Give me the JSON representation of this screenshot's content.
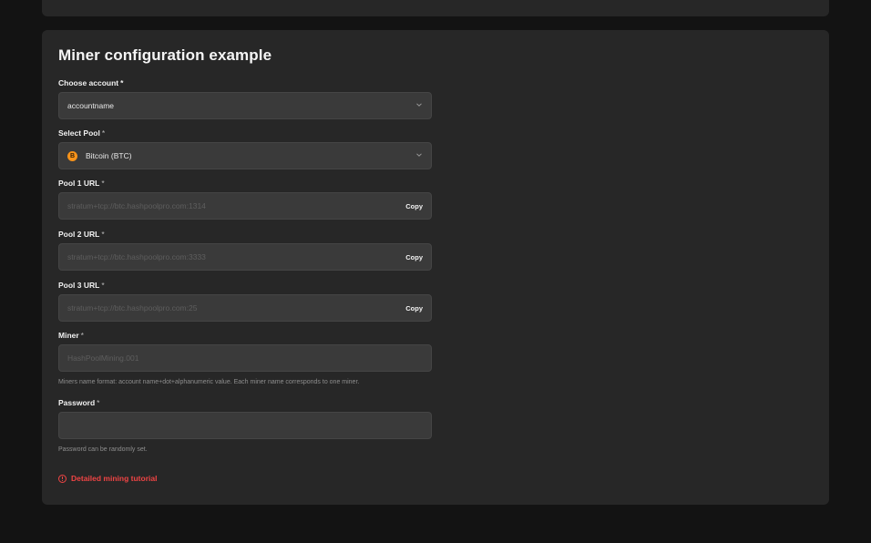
{
  "title": "Miner configuration example",
  "account": {
    "label": "Choose account",
    "required": "*",
    "value": "accountname"
  },
  "pool": {
    "label": "Select Pool",
    "required": "*",
    "value": "Bitcoin (BTC)",
    "coin_symbol": "B",
    "coin_color": "#f7931a"
  },
  "pool_urls": [
    {
      "label": "Pool 1 URL",
      "required": "*",
      "placeholder": "stratum+tcp://btc.hashpoolpro.com:1314",
      "copy_label": "Copy"
    },
    {
      "label": "Pool 2 URL",
      "required": "*",
      "placeholder": "stratum+tcp://btc.hashpoolpro.com:3333",
      "copy_label": "Copy"
    },
    {
      "label": "Pool 3 URL",
      "required": "*",
      "placeholder": "stratum+tcp://btc.hashpoolpro.com:25",
      "copy_label": "Copy"
    }
  ],
  "miner": {
    "label": "Miner",
    "required": "*",
    "placeholder": "HashPoolMining.001",
    "hint": "Miners name format: account name+dot+alphanumeric value. Each miner name corresponds to one miner."
  },
  "password": {
    "label": "Password",
    "required": "*",
    "value": "",
    "hint": "Password can be randomly set."
  },
  "tutorial": {
    "label": "Detailed mining tutorial",
    "icon": "info-circle-icon",
    "color": "#ef4444"
  }
}
